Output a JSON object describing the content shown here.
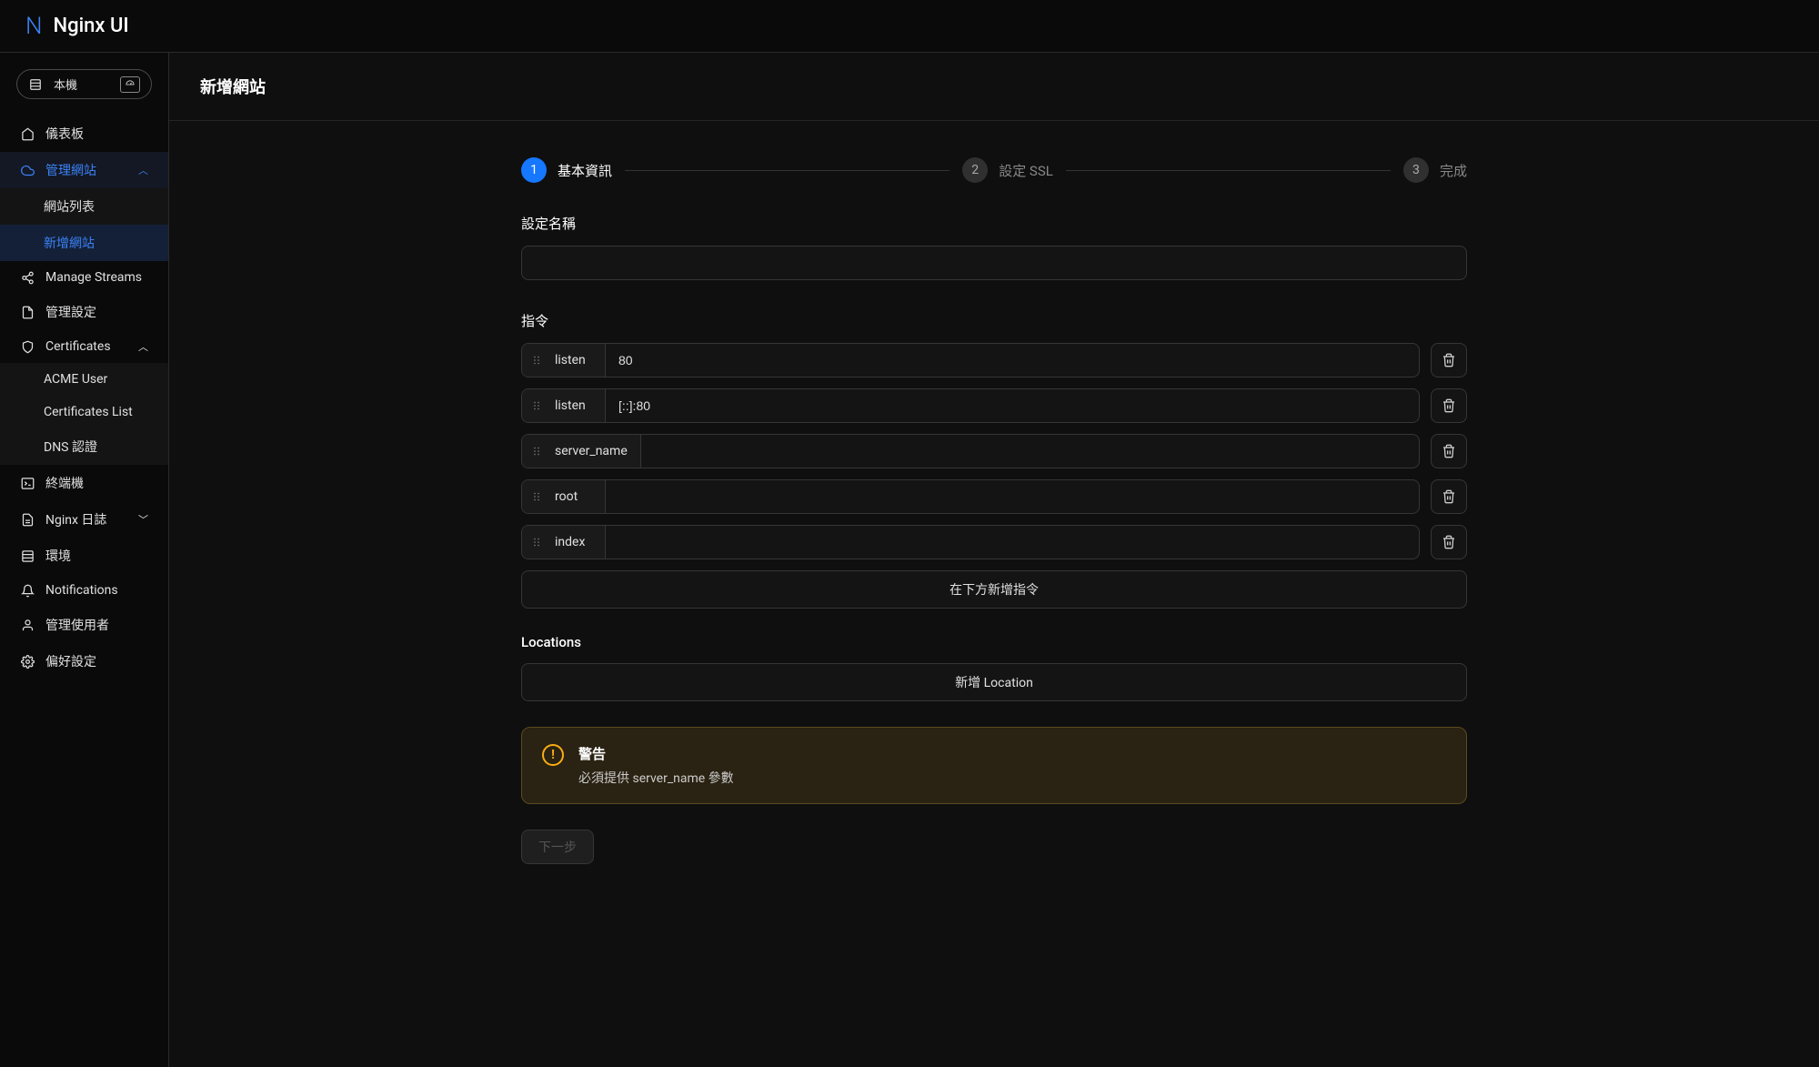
{
  "app": {
    "name": "Nginx UI"
  },
  "env_selector": {
    "label": "本機"
  },
  "sidebar": {
    "dashboard": "儀表板",
    "manage_sites": "管理網站",
    "site_list": "網站列表",
    "add_site": "新增網站",
    "manage_streams": "Manage Streams",
    "manage_config": "管理設定",
    "certificates": "Certificates",
    "acme_user": "ACME User",
    "certificates_list": "Certificates List",
    "dns_auth": "DNS 認證",
    "terminal": "終端機",
    "nginx_log": "Nginx 日誌",
    "environment": "環境",
    "notifications": "Notifications",
    "manage_users": "管理使用者",
    "preferences": "偏好設定"
  },
  "page": {
    "title": "新增網站"
  },
  "steps": {
    "s1": "基本資訊",
    "s2": "設定 SSL",
    "s3": "完成"
  },
  "form": {
    "config_name_label": "設定名稱",
    "config_name_value": "",
    "directives_label": "指令",
    "add_directive_btn": "在下方新增指令",
    "locations_label": "Locations",
    "add_location_btn": "新增 Location",
    "next_btn": "下一步"
  },
  "directives": [
    {
      "name": "listen",
      "value": "80"
    },
    {
      "name": "listen",
      "value": "[::]:80"
    },
    {
      "name": "server_name",
      "value": ""
    },
    {
      "name": "root",
      "value": ""
    },
    {
      "name": "index",
      "value": ""
    }
  ],
  "alert": {
    "title": "警告",
    "message": "必須提供 server_name 參數"
  }
}
